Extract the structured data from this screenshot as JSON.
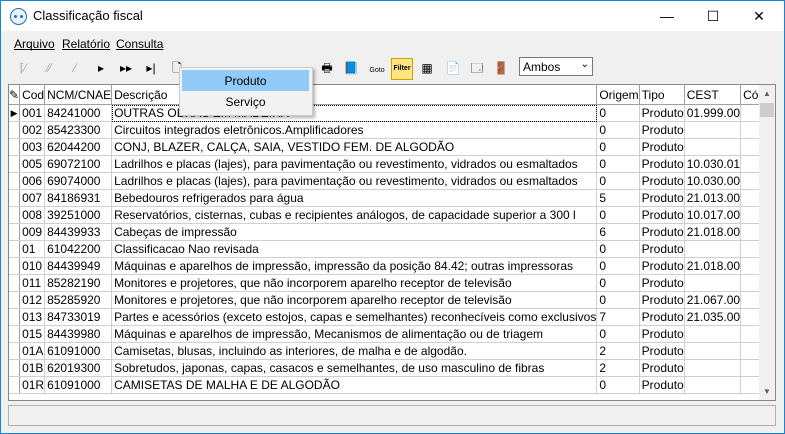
{
  "window": {
    "title": "Classificação fiscal",
    "controls": [
      "—",
      "☐",
      "✕"
    ]
  },
  "menu": [
    {
      "label": "Arquivo"
    },
    {
      "label": "Relatório"
    },
    {
      "label": "Consulta"
    }
  ],
  "toolbar": {
    "filter_select": {
      "value": "Ambos"
    },
    "goto_label": "Goto",
    "filter_label": "Filter"
  },
  "dropdown": {
    "items": [
      {
        "label": "Produto"
      },
      {
        "label": "Serviço"
      }
    ],
    "highlighted": "Produto"
  },
  "grid": {
    "columns": [
      "Cod",
      "NCM/CNAE",
      "Descrição",
      "Origem",
      "Tipo",
      "CEST",
      "Cód. Trib. Município"
    ],
    "rows": [
      {
        "cod": "001",
        "ncm": "84241000",
        "desc": "OUTRAS OBRAS EM MADEIRA",
        "origem": "0",
        "tipo": "Produto",
        "cest": "01.999.00",
        "trib": ""
      },
      {
        "cod": "002",
        "ncm": "85423300",
        "desc": "Circuitos integrados eletrônicos.Amplificadores",
        "origem": "0",
        "tipo": "Produto",
        "cest": "",
        "trib": ""
      },
      {
        "cod": "003",
        "ncm": "62044200",
        "desc": "CONJ, BLAZER, CALÇA, SAIA, VESTIDO FEM. DE ALGODÃO",
        "origem": "0",
        "tipo": "Produto",
        "cest": "",
        "trib": ""
      },
      {
        "cod": "005",
        "ncm": "69072100",
        "desc": "Ladrilhos e placas (lajes), para pavimentação ou revestimento, vidrados ou esmaltados",
        "origem": "0",
        "tipo": "Produto",
        "cest": "10.030.01",
        "trib": ""
      },
      {
        "cod": "006",
        "ncm": "69074000",
        "desc": "Ladrilhos e placas (lajes), para pavimentação ou revestimento, vidrados ou esmaltados",
        "origem": "0",
        "tipo": "Produto",
        "cest": "10.030.00",
        "trib": ""
      },
      {
        "cod": "007",
        "ncm": "84186931",
        "desc": "Bebedouros refrigerados para água",
        "origem": "5",
        "tipo": "Produto",
        "cest": "21.013.00",
        "trib": ""
      },
      {
        "cod": "008",
        "ncm": "39251000",
        "desc": "Reservatórios, cisternas, cubas e recipientes análogos, de capacidade superior a 300 l",
        "origem": "0",
        "tipo": "Produto",
        "cest": "10.017.00",
        "trib": ""
      },
      {
        "cod": "009",
        "ncm": "84439933",
        "desc": "Cabeças de impressão",
        "origem": "6",
        "tipo": "Produto",
        "cest": "21.018.00",
        "trib": ""
      },
      {
        "cod": "01",
        "ncm": "61042200",
        "desc": "Classificacao Nao revisada",
        "origem": "0",
        "tipo": "Produto",
        "cest": "",
        "trib": ""
      },
      {
        "cod": "010",
        "ncm": "84439949",
        "desc": "Máquinas e aparelhos de impressão, impressão da posição 84.42; outras impressoras",
        "origem": "0",
        "tipo": "Produto",
        "cest": "21.018.00",
        "trib": ""
      },
      {
        "cod": "011",
        "ncm": "85282190",
        "desc": " Monitores e projetores, que não incorporem aparelho receptor de televisão",
        "origem": "0",
        "tipo": "Produto",
        "cest": "",
        "trib": ""
      },
      {
        "cod": "012",
        "ncm": "85285920",
        "desc": "Monitores e projetores, que não incorporem aparelho receptor de televisão",
        "origem": "0",
        "tipo": "Produto",
        "cest": "21.067.00",
        "trib": ""
      },
      {
        "cod": "013",
        "ncm": "84733019",
        "desc": "Partes e acessórios (exceto estojos, capas e semelhantes) reconhecíveis como exclusivos",
        "origem": "7",
        "tipo": "Produto",
        "cest": "21.035.00",
        "trib": ""
      },
      {
        "cod": "015",
        "ncm": "84439980",
        "desc": "Máquinas e aparelhos de impressão, Mecanismos de alimentação ou de triagem",
        "origem": "0",
        "tipo": "Produto",
        "cest": "",
        "trib": ""
      },
      {
        "cod": "01A",
        "ncm": "61091000",
        "desc": "Camisetas, blusas, incluindo as interiores, de malha e de algodão.",
        "origem": "2",
        "tipo": "Produto",
        "cest": "",
        "trib": ""
      },
      {
        "cod": "01B",
        "ncm": "62019300",
        "desc": "Sobretudos, japonas, capas, casacos e semelhantes, de uso masculino de fibras",
        "origem": "2",
        "tipo": "Produto",
        "cest": "",
        "trib": ""
      },
      {
        "cod": "01R",
        "ncm": "61091000",
        "desc": "CAMISETAS DE MALHA E DE ALGODÃO",
        "origem": "0",
        "tipo": "Produto",
        "cest": "",
        "trib": ""
      }
    ]
  }
}
